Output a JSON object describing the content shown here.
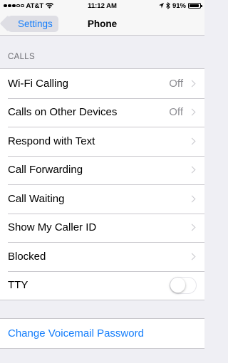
{
  "status_bar": {
    "carrier": "AT&T",
    "time": "11:12 AM",
    "battery_percent": "91%",
    "battery_level": 0.91,
    "signal_bars_filled": 3,
    "signal_bars_total": 5,
    "icons": [
      "wifi-icon",
      "location-icon",
      "bluetooth-icon",
      "battery-icon"
    ]
  },
  "nav": {
    "back_label": "Settings",
    "title": "Phone"
  },
  "calls_section": {
    "header": "CALLS",
    "rows": [
      {
        "label": "Wi-Fi Calling",
        "value": "Off"
      },
      {
        "label": "Calls on Other Devices",
        "value": "Off"
      },
      {
        "label": "Respond with Text"
      },
      {
        "label": "Call Forwarding"
      },
      {
        "label": "Call Waiting"
      },
      {
        "label": "Show My Caller ID"
      },
      {
        "label": "Blocked"
      },
      {
        "label": "TTY",
        "toggle": "off"
      }
    ]
  },
  "voicemail": {
    "link_label": "Change Voicemail Password"
  },
  "colors": {
    "accent": "#157efb",
    "background": "#efeff4",
    "secondary_text": "#8e8e93",
    "separator": "#c8c7cc"
  }
}
